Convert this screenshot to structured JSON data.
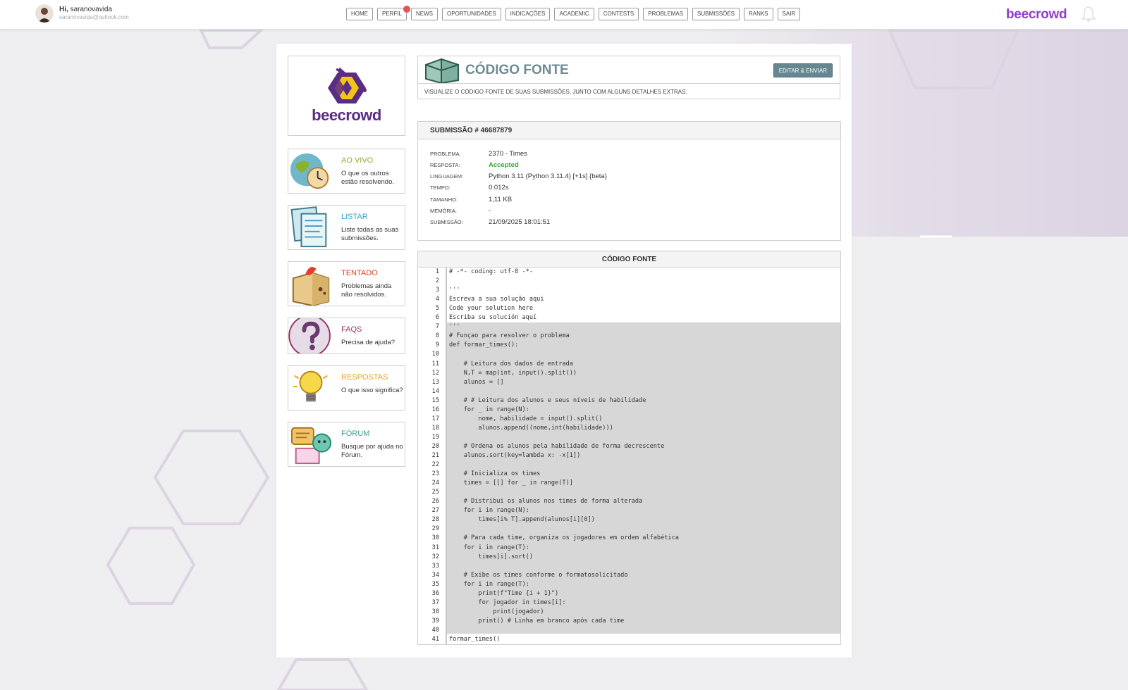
{
  "user": {
    "greeting": "Hi,",
    "name": "saranovavida",
    "email": "saranovavida@outlook.com"
  },
  "nav": [
    "HOME",
    "PERFIL",
    "NEWS",
    "OPORTUNIDADES",
    "INDICAÇÕES",
    "ACADEMIC",
    "CONTESTS",
    "PROBLEMAS",
    "SUBMISSÕES",
    "RANKS",
    "SAIR"
  ],
  "brand": "beecrowd",
  "logo_text": "beecrowd",
  "menu": [
    {
      "title": "AO VIVO",
      "desc": "O que os outros estão resolvendo.",
      "color": "#8cb12b"
    },
    {
      "title": "LISTAR",
      "desc": "Liste todas as suas submissões.",
      "color": "#3aa0c8"
    },
    {
      "title": "TENTADO",
      "desc": "Problemas ainda não resolvidos.",
      "color": "#e0412c"
    },
    {
      "title": "FAQS",
      "desc": "Precisa de ajuda?",
      "color": "#9b2f6b"
    },
    {
      "title": "RESPOSTAS",
      "desc": "O que isso significa?",
      "color": "#e8a21c"
    },
    {
      "title": "FÓRUM",
      "desc": "Busque por ajuda no Fórum.",
      "color": "#3aa58c"
    }
  ],
  "header": {
    "title": "CÓDIGO FONTE",
    "button": "EDITAR & ENVIAR",
    "desc": "VISUALIZE O CÓDIGO FONTE DE SUAS SUBMISSÕES, JUNTO COM ALGUNS DETALHES EXTRAS."
  },
  "submission": {
    "title": "SUBMISSÃO # 46687879",
    "rows": [
      {
        "label": "PROBLEMA:",
        "value": "2370 - Times"
      },
      {
        "label": "RESPOSTA:",
        "value": "Accepted"
      },
      {
        "label": "LINGUAGEM:",
        "value": "Python 3.11 (Python 3.11.4) [+1s] {beta}"
      },
      {
        "label": "TEMPO:",
        "value": "0.012s"
      },
      {
        "label": "TAMANHO:",
        "value": "1,11 KB"
      },
      {
        "label": "MEMÓRIA:",
        "value": "-"
      },
      {
        "label": "SUBMISSÃO:",
        "value": "21/09/2025 18:01:51"
      }
    ]
  },
  "code": {
    "title": "CÓDIGO FONTE",
    "lines": [
      "# -*- coding: utf-8 -*-",
      "",
      "'''",
      "Escreva a sua solução aqui",
      "Code your solution here",
      "Escriba su solución aquí",
      "'''",
      "# Funçao para resolver o problema",
      "def formar_times():",
      "",
      "    # Leitura dos dados de entrada",
      "    N,T = map(int, input().split())",
      "    alunos = []",
      "",
      "    # # Leitura dos alunos e seus níveis de habilidade",
      "    for _ in range(N):",
      "        nome, habilidade = input().split()",
      "        alunos.append((nome,int(habilidade)))",
      "",
      "    # Ordena os alunos pela habilidade de forma decrescente",
      "    alunos.sort(key=lambda x: -x[1])",
      "",
      "    # Inicializa os times",
      "    times = [[] for _ in range(T)]",
      "",
      "    # Distribui os alunos nos times de forma alterada",
      "    for i in range(N):",
      "        times[i% T].append(alunos[i][0])",
      "",
      "    # Para cada time, organiza os jogadores em ordem alfabética",
      "    for i in range(T):",
      "        times[i].sort()",
      "",
      "    # Exibe os times conforme o formatosolicitado",
      "    for i in range(T):",
      "        print(f\"Time {i + 1}\")",
      "        for jogador in times[i]:",
      "            print(jogador)",
      "        print() # Linha em branco após cada time",
      "",
      "formar_times()"
    ]
  }
}
